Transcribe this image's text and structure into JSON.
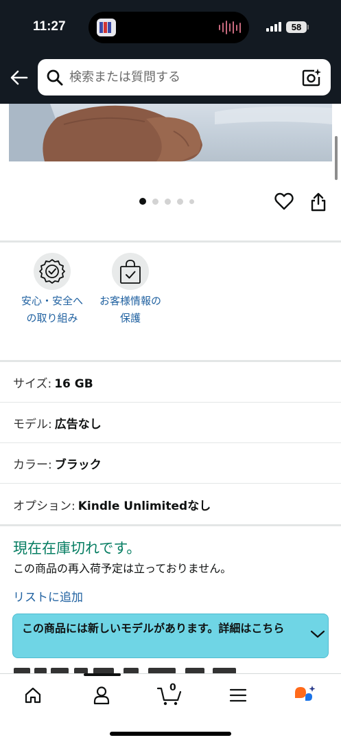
{
  "status_bar": {
    "time": "11:27",
    "battery": "58"
  },
  "search": {
    "placeholder": "検索または質問する",
    "icons": {
      "back": "arrow-left-icon",
      "search": "magnifier-icon",
      "camera": "camera-sparkle-icon"
    }
  },
  "gallery": {
    "dot_count": 5,
    "active_index": 0,
    "icons": {
      "favorite": "heart-icon",
      "share": "share-icon"
    }
  },
  "trust_badges": [
    {
      "label_line1": "安心・安全へ",
      "label_line2": "の取り組み",
      "icon": "shield-check-icon"
    },
    {
      "label_line1": "お客様情報の",
      "label_line2": "保護",
      "icon": "shopping-bag-check-icon"
    }
  ],
  "options": [
    {
      "key": "サイズ:",
      "value": "16 GB"
    },
    {
      "key": "モデル:",
      "value": "広告なし"
    },
    {
      "key": "カラー:",
      "value": "ブラック"
    },
    {
      "key": "オプション:",
      "value": "Kindle Unlimitedなし"
    }
  ],
  "availability": {
    "status": "現在在庫切れです。",
    "note": "この商品の再入荷予定は立っておりません。",
    "add_to_list": "リストに追加"
  },
  "new_model_banner": {
    "text": "この商品には新しいモデルがあります。詳細はこちら"
  },
  "bottom_nav": {
    "cart_count": "0",
    "items": [
      "home-icon",
      "account-icon",
      "cart-icon",
      "menu-icon",
      "rufus-assistant-icon"
    ]
  },
  "colors": {
    "header_bg": "#131a22",
    "link": "#2162a1",
    "in_stock_green": "#067d62",
    "banner_bg": "#6fd5e5"
  }
}
